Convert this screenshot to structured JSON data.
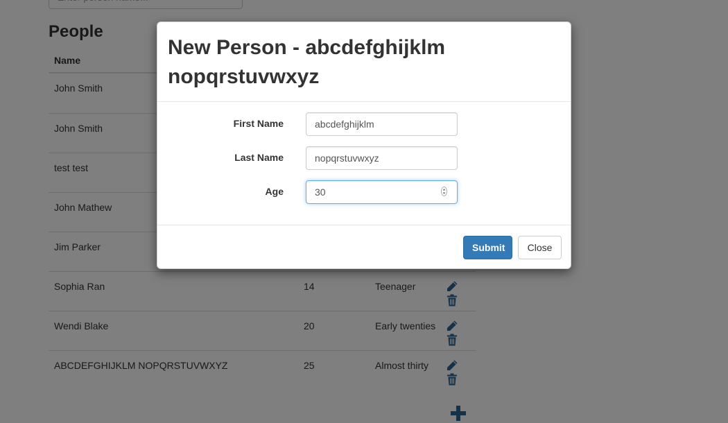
{
  "search": {
    "placeholder": "Enter person name..."
  },
  "people": {
    "heading": "People",
    "columns": {
      "name": "Name"
    },
    "rows": [
      {
        "name": "John Smith",
        "age": "",
        "description": ""
      },
      {
        "name": "John Smith",
        "age": "",
        "description": ""
      },
      {
        "name": "test test",
        "age": "",
        "description": ""
      },
      {
        "name": "John Mathew",
        "age": "",
        "description": ""
      },
      {
        "name": "Jim Parker",
        "age": "",
        "description": ""
      },
      {
        "name": "Sophia Ran",
        "age": "14",
        "description": "Teenager"
      },
      {
        "name": "Wendi Blake",
        "age": "20",
        "description": "Early twenties"
      },
      {
        "name": "ABCDEFGHIJKLM NOPQRSTUVWXYZ",
        "age": "25",
        "description": "Almost thirty"
      }
    ],
    "row_actions": {
      "edit_icon": "pencil-icon",
      "delete_icon": "trash-icon"
    },
    "add_icon": "plus-icon"
  },
  "modal": {
    "title": "New Person - abcdefghijklm nopqrstuvwxyz",
    "fields": {
      "first_name": {
        "label": "First Name",
        "value": "abcdefghijklm"
      },
      "last_name": {
        "label": "Last Name",
        "value": "nopqrstuvwxyz"
      },
      "age": {
        "label": "Age",
        "value": "30"
      }
    },
    "submit_label": "Submit",
    "close_label": "Close"
  },
  "colors": {
    "primary": "#337ab7",
    "icon": "#2a6496",
    "focus": "#66afe9"
  }
}
